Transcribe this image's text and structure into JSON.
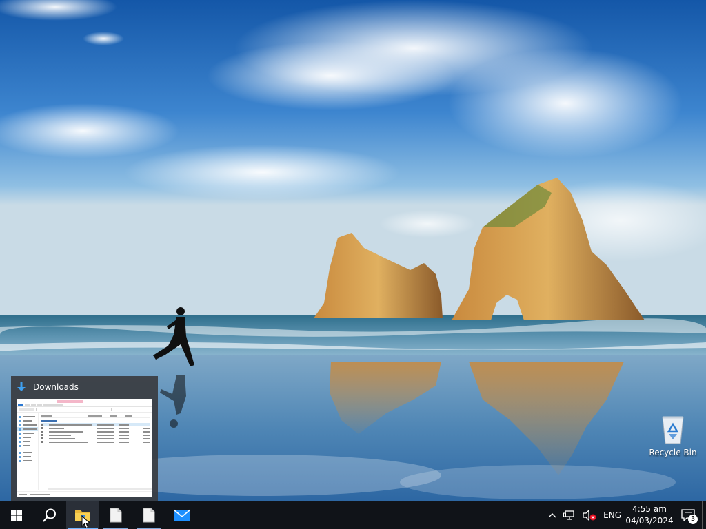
{
  "desktop": {
    "icons": [
      {
        "label": "Recycle Bin",
        "icon": "recycle-bin-icon"
      }
    ]
  },
  "preview": {
    "title": "Downloads",
    "icon": "downloads-arrow-icon"
  },
  "taskbar": {
    "buttons": [
      {
        "name": "start",
        "icon": "windows-logo-icon"
      },
      {
        "name": "search",
        "icon": "search-icon"
      },
      {
        "name": "file-explorer",
        "icon": "folder-icon",
        "active": true
      },
      {
        "name": "document-1",
        "icon": "document-icon",
        "open": true
      },
      {
        "name": "document-2",
        "icon": "document-icon",
        "open": true
      },
      {
        "name": "mail",
        "icon": "mail-icon"
      }
    ],
    "tray": {
      "language": "ENG",
      "time": "4:55 am",
      "date": "04/03/2024",
      "notification_count": "3"
    }
  },
  "colors": {
    "taskbar": "#101318",
    "accent": "#6fb3ff",
    "sky": "#1a5fa8"
  }
}
